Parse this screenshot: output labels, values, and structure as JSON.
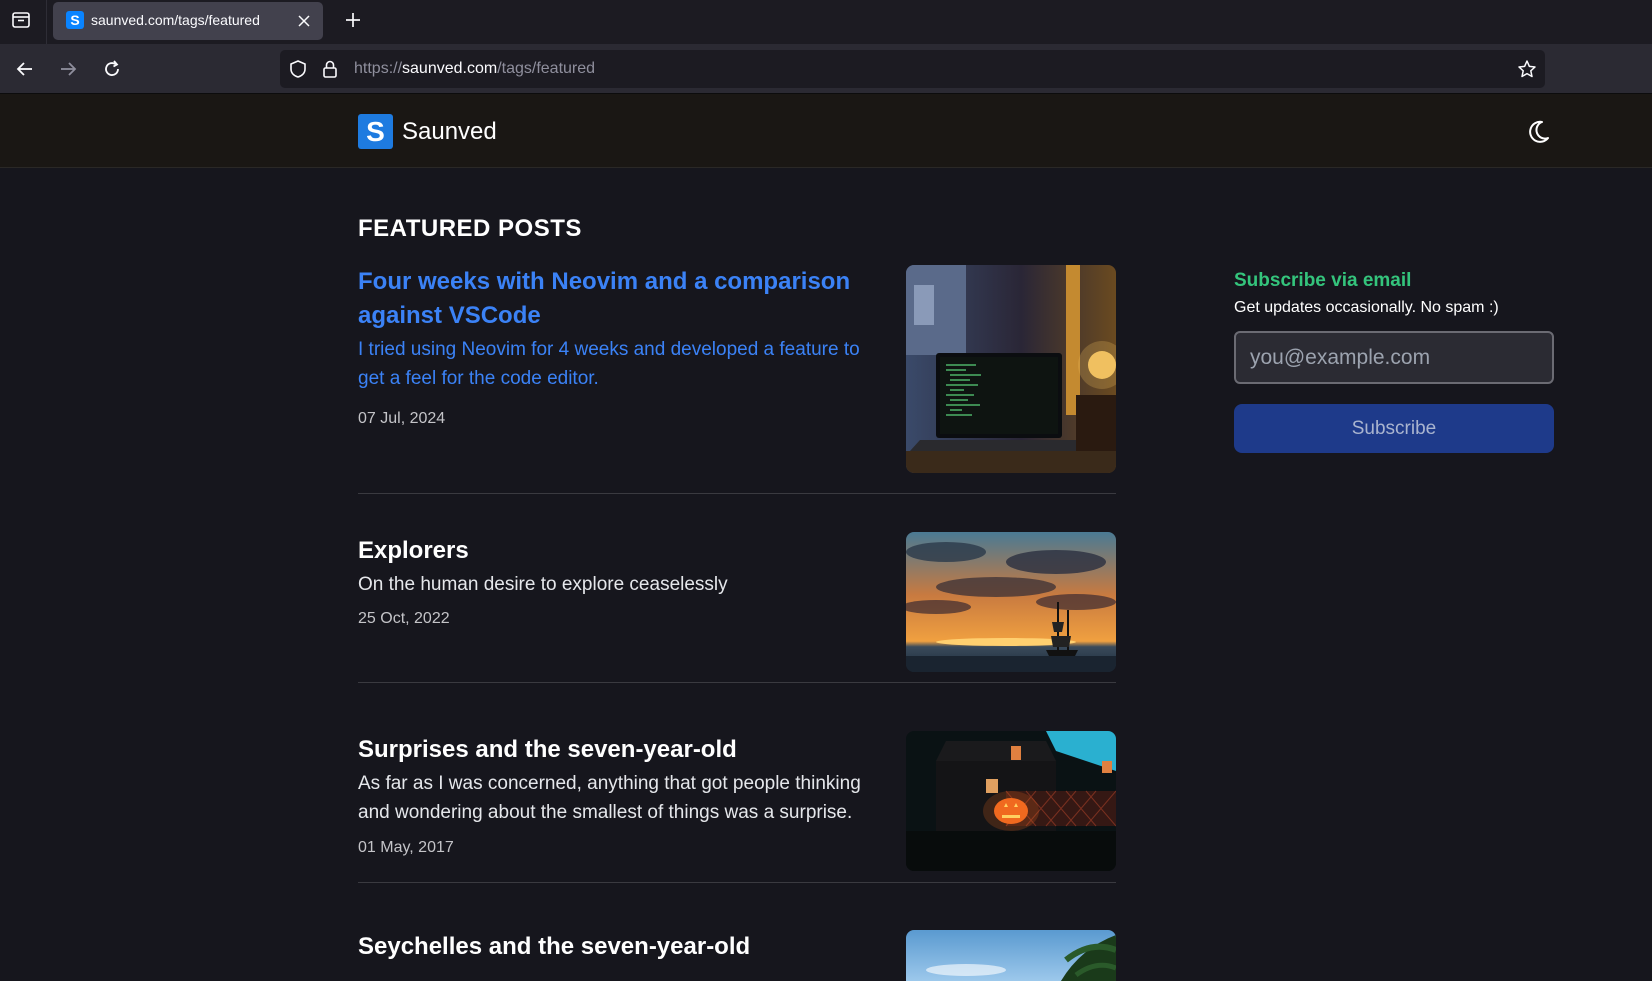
{
  "browser": {
    "tab_title": "saunved.com/tags/featured",
    "tab_favicon_letter": "S",
    "url_scheme": "https://",
    "url_host": "saunved.com",
    "url_path": "/tags/featured"
  },
  "site": {
    "logo_letter": "S",
    "name": "Saunved"
  },
  "section_title": "FEATURED POSTS",
  "posts": [
    {
      "title": "Four weeks with Neovim and a comparison against VSCode",
      "description": "I tried using Neovim for 4 weeks and developed a feature to get a feel for the code editor.",
      "date": "07 Jul, 2024"
    },
    {
      "title": "Explorers",
      "description": "On the human desire to explore ceaselessly",
      "date": "25 Oct, 2022"
    },
    {
      "title": "Surprises and the seven-year-old",
      "description": "As far as I was concerned, anything that got people thinking and wondering about the smallest of things was a surprise.",
      "date": "01 May, 2017"
    },
    {
      "title": "Seychelles and the seven-year-old",
      "description": "",
      "date": ""
    }
  ],
  "subscribe": {
    "title": "Subscribe via email",
    "text": "Get updates occasionally. No spam :)",
    "placeholder": "you@example.com",
    "button_label": "Subscribe"
  },
  "colors": {
    "accent_blue": "#3b82f6",
    "accent_green": "#34c47c",
    "button_bg": "#1e3a8a"
  }
}
